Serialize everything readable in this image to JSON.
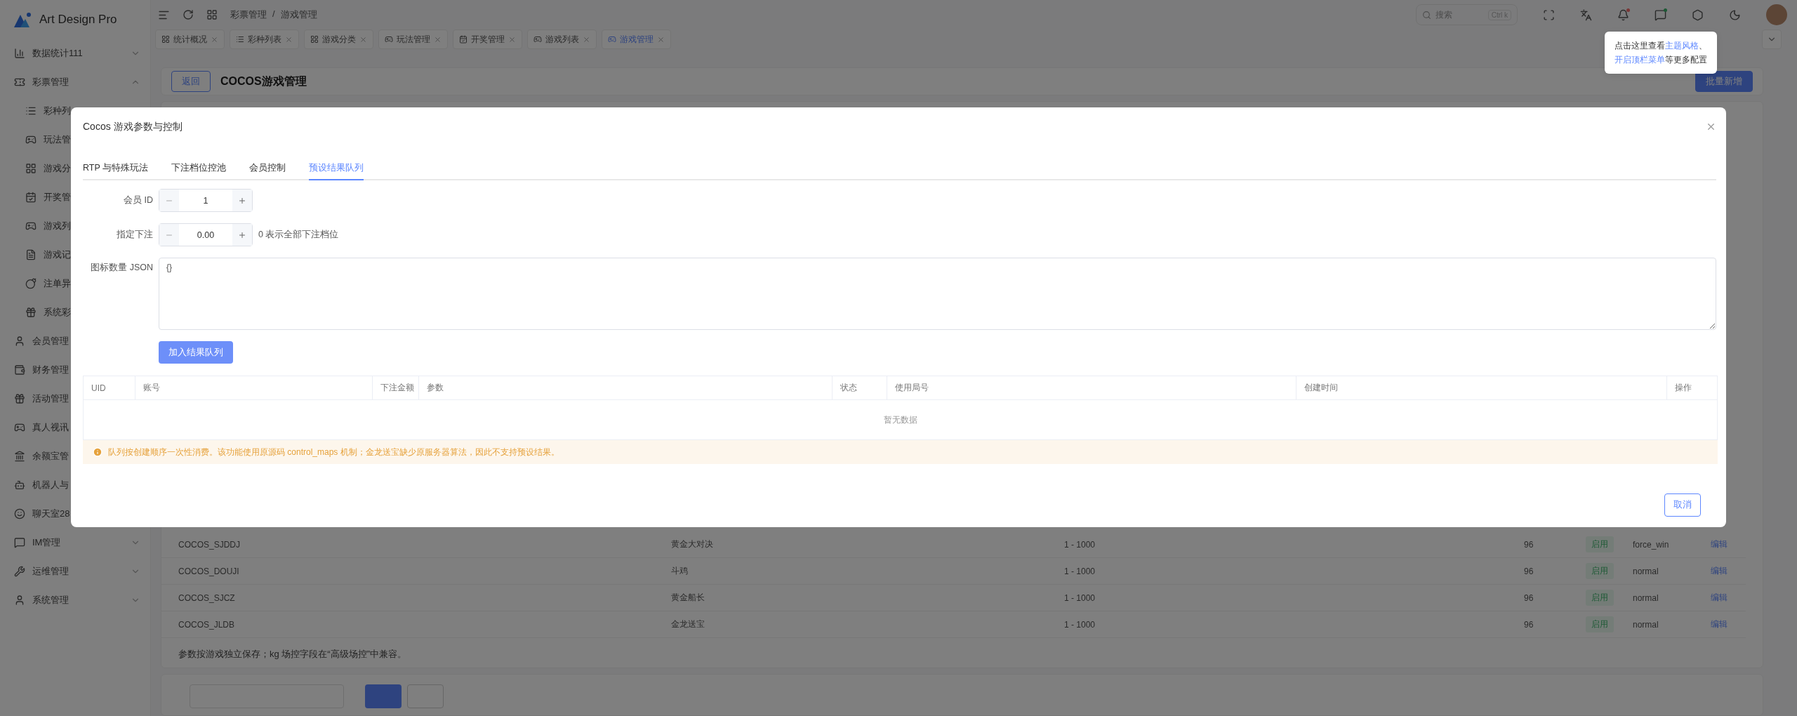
{
  "sidebar": {
    "logo": "Art Design Pro",
    "items": [
      {
        "label": "数据统计111",
        "expanded": false
      },
      {
        "label": "彩票管理",
        "expanded": true,
        "children": [
          {
            "label": "彩种列"
          },
          {
            "label": "玩法管"
          },
          {
            "label": "游戏分"
          },
          {
            "label": "开奖管"
          },
          {
            "label": "游戏列"
          },
          {
            "label": "游戏记"
          },
          {
            "label": "注单异"
          },
          {
            "label": "系统彩"
          }
        ]
      },
      {
        "label": "会员管理"
      },
      {
        "label": "财务管理"
      },
      {
        "label": "活动管理"
      },
      {
        "label": "真人视讯"
      },
      {
        "label": "余额宝管"
      },
      {
        "label": "机器人与"
      },
      {
        "label": "聊天室28"
      },
      {
        "label": "IM管理",
        "expanded": false
      },
      {
        "label": "运维管理",
        "expanded": false
      },
      {
        "label": "系统管理",
        "expanded": false
      }
    ]
  },
  "header": {
    "breadcrumb": [
      "彩票管理",
      "/",
      "游戏管理"
    ],
    "search": {
      "placeholder": "搜索",
      "shortcut": "Ctrl k"
    },
    "tooltip": [
      [
        {
          "text": "点击这里查看",
          "highlight": false
        },
        {
          "text": "主题风格",
          "highlight": true
        },
        {
          "text": "、",
          "highlight": false
        }
      ],
      [
        {
          "text": "开启顶栏菜单",
          "highlight": true
        },
        {
          "text": "等更多配置",
          "highlight": false
        }
      ]
    ]
  },
  "tabs": [
    {
      "label": "统计概况",
      "selected": false
    },
    {
      "label": "彩种列表",
      "selected": false
    },
    {
      "label": "游戏分类",
      "selected": false
    },
    {
      "label": "玩法管理",
      "selected": false
    },
    {
      "label": "开奖管理",
      "selected": false
    },
    {
      "label": "游戏列表",
      "selected": false
    },
    {
      "label": "游戏管理",
      "selected": true
    }
  ],
  "page": {
    "back": "返回",
    "title": "COCOS游戏管理",
    "add": "批量新增"
  },
  "table": {
    "rows": [
      {
        "column_1": "COCOS_SJDDJ",
        "column_2": "黄金大对决",
        "column_3": "1 - 1000",
        "column_4": "96",
        "column_5": "启用",
        "column_6": "force_win",
        "column_7": "编辑"
      },
      {
        "column_1": "COCOS_DOUJI",
        "column_2": "斗鸡",
        "column_3": "1 - 1000",
        "column_4": "96",
        "column_5": "启用",
        "column_6": "normal",
        "column_7": "编辑"
      },
      {
        "column_1": "COCOS_SJCZ",
        "column_2": "黄金船长",
        "column_3": "1 - 1000",
        "column_4": "96",
        "column_5": "启用",
        "column_6": "normal",
        "column_7": "编辑"
      },
      {
        "column_1": "COCOS_JLDB",
        "column_2": "金龙送宝",
        "column_3": "1 - 1000",
        "column_4": "96",
        "column_5": "启用",
        "column_6": "normal",
        "column_7": "编辑"
      }
    ],
    "note": "参数按游戏独立保存；kg 场控字段在“高级场控”中兼容。"
  },
  "modal": {
    "title": "Cocos 游戏参数与控制",
    "tabs": [
      {
        "label": "RTP 与特殊玩法",
        "selected": false
      },
      {
        "label": "下注档位控池",
        "selected": false
      },
      {
        "label": "会员控制",
        "selected": false
      },
      {
        "label": "预设结果队列",
        "selected": true
      }
    ],
    "member_id": {
      "label": "会员 ID",
      "value": "1"
    },
    "bet": {
      "label": "指定下注",
      "value": "0.00",
      "hint": "0 表示全部下注档位"
    },
    "json": {
      "label": "图标数量 JSON",
      "value": "{}"
    },
    "submit": "加入结果队列",
    "table": {
      "columns": [
        "UID",
        "账号",
        "下注金额",
        "参数",
        "状态",
        "使用局号",
        "创建时间",
        "操作"
      ],
      "empty": "暂无数据"
    },
    "alert": "队列按创建顺序一次性消费。该功能使用原源码 control_maps 机制；金龙送宝缺少原服务器算法，因此不支持预设结果。",
    "cancel": "取消"
  }
}
